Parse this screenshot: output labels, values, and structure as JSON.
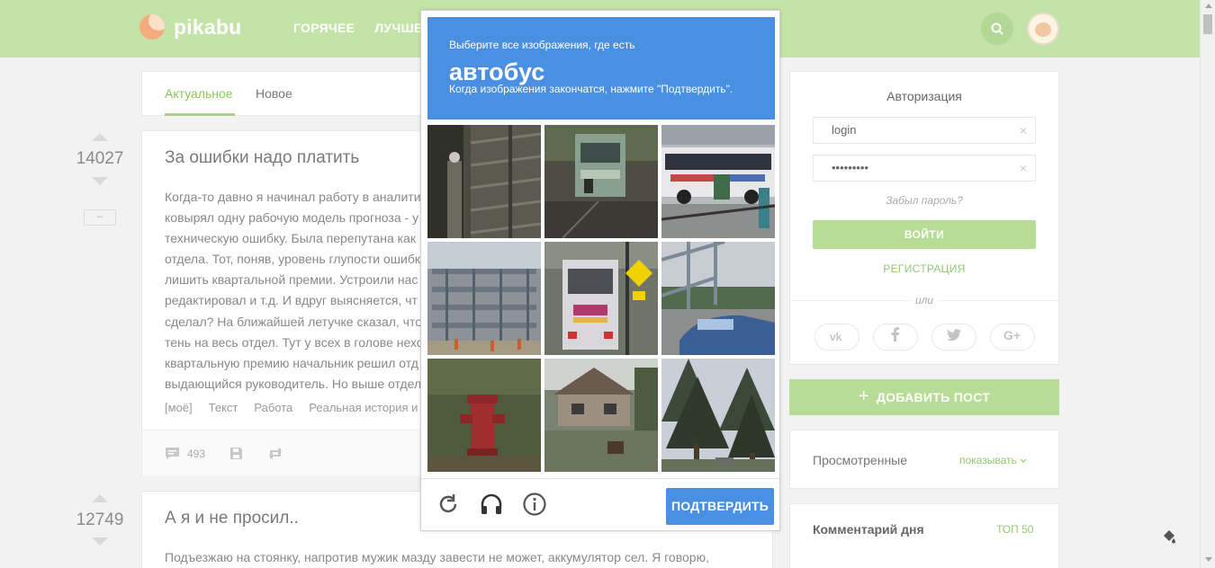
{
  "header": {
    "logo_text": "pikabu",
    "nav": [
      "ГОРЯЧЕЕ",
      "ЛУЧШЕ"
    ]
  },
  "feed": {
    "tabs": [
      "Актуальное",
      "Новое"
    ],
    "posts": [
      {
        "rating": "14027",
        "minus_label": "–",
        "title": "За ошибки надо платить",
        "body_lines": [
          "Когда-то давно я начинал работу в аналити",
          "ковырял одну рабочую модель прогноза - у",
          "техническую ошибку. Была перепутана как",
          "отдела. Тот, поняв, уровень глупости ошибк",
          "лишить квартальной премии. Устроили нас",
          "редактировал и т.д. И вдруг выясняется, чт",
          "сделал? На ближайшей летучке сказал, что",
          "тень на весь отдел. Тут у всех в голове нехс",
          "квартальную премию начальник решил отд",
          "выдающийся руководитель. Но выше отдел"
        ],
        "tags": [
          "[моё]",
          "Текст",
          "Работа",
          "Реальная история и"
        ],
        "comments_count": "493"
      },
      {
        "rating": "12749",
        "title": "А я и не просил..",
        "body_lines": [
          "Подъезжаю на стоянку, напротив мужик мазду завести не может, аккумулятор сел. Я говорю,"
        ]
      }
    ]
  },
  "auth": {
    "title": "Авторизация",
    "login_value": "login",
    "password_value": "•••••••••",
    "clear_glyph": "×",
    "forgot": "Забыл пароль?",
    "login_button": "ВОЙТИ",
    "register": "РЕГИСТРАЦИЯ",
    "or": "или",
    "social": [
      "vk",
      "f",
      "twitter",
      "G+"
    ]
  },
  "add_post": {
    "plus": "+",
    "label": "ДОБАВИТЬ ПОСТ"
  },
  "viewed": {
    "label": "Просмотренные",
    "link": "показывать"
  },
  "comment_day": {
    "label": "Комментарий дня",
    "link": "ТОП 50"
  },
  "captcha": {
    "line1": "Выберите все изображения, где есть",
    "word": "автобус",
    "line2": "Когда изображения закончатся, нажмите \"Подтвердить\".",
    "verify_button": "ПОДТВЕРДИТЬ",
    "tiles": [
      "stairs-railing",
      "street-bus-rear",
      "city-bus",
      "building-facade",
      "bus-rear-stop",
      "bridge-car",
      "fire-hydrant",
      "house-street",
      "pine-trees"
    ]
  },
  "colors": {
    "header_bg": "#c4e3a8",
    "accent_green": "#94c970",
    "button_green": "#b6dc95",
    "captcha_blue": "#4a90e2"
  }
}
